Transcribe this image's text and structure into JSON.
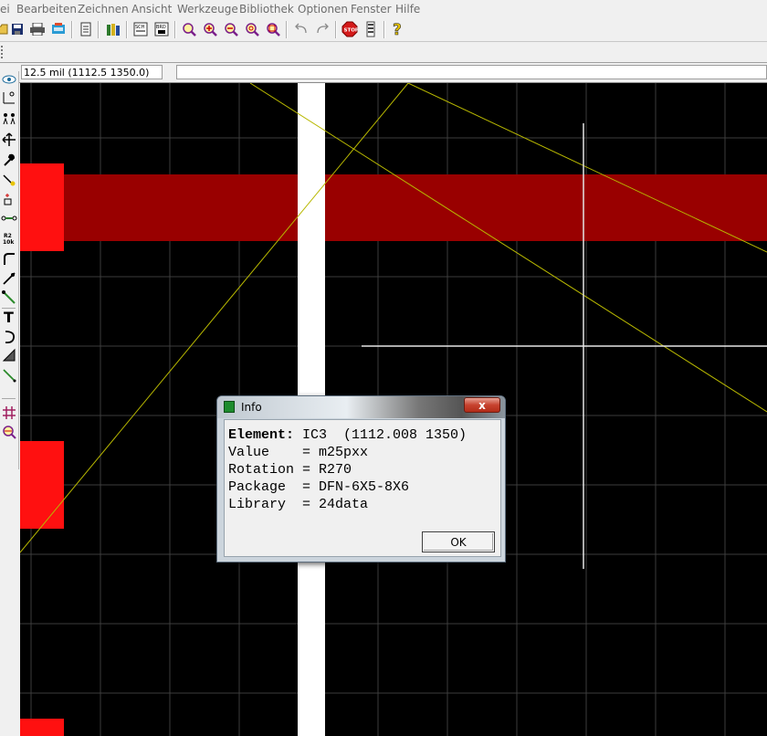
{
  "menu": [
    "ei",
    "Bearbeiten",
    "Zeichnen",
    "Ansicht",
    "Werkzeuge",
    "Bibliothek",
    "Optionen",
    "Fenster",
    "Hilfe"
  ],
  "toolbar_icons": [
    "open-icon",
    "save-icon",
    "print-icon",
    "cam-icon",
    "script-icon",
    "library-icon",
    "schematic-icon",
    "board-icon",
    "zoom-fit-icon",
    "zoom-in-icon",
    "zoom-out-icon",
    "zoom-redraw-icon",
    "zoom-select-icon",
    "undo-icon",
    "redo-icon",
    "stop-icon",
    "go-icon",
    "help-icon"
  ],
  "status": {
    "coordinates": "12.5 mil (1112.5 1350.0)",
    "command": ""
  },
  "left_tools": [
    "info-icon",
    "show-icon",
    "mark-icon",
    "move-icon",
    "copy-icon",
    "mirror-icon",
    "rotate-icon",
    "group-icon",
    "change-icon",
    "name-icon",
    "value-icon",
    "smash-icon",
    "miter-icon",
    "split-icon",
    "route-icon",
    "text-icon",
    "arc-icon",
    "polygon-icon",
    "wire-icon",
    "grid-icon",
    "drc-icon"
  ],
  "colors": {
    "top_copper": "#990000",
    "pad": "#ff0000",
    "dimension": "#ffffff",
    "airwire": "#b8b800",
    "grid": "#404040",
    "background": "#000000"
  },
  "dialog": {
    "title": "Info",
    "close": "x",
    "element_label": "Element:",
    "element_value": "IC3  (1112.008 1350)",
    "lines": [
      "Value    = m25pxx",
      "Rotation = R270",
      "Package  = DFN-6X5-8X6",
      "Library  = 24data"
    ],
    "ok": "OK"
  }
}
